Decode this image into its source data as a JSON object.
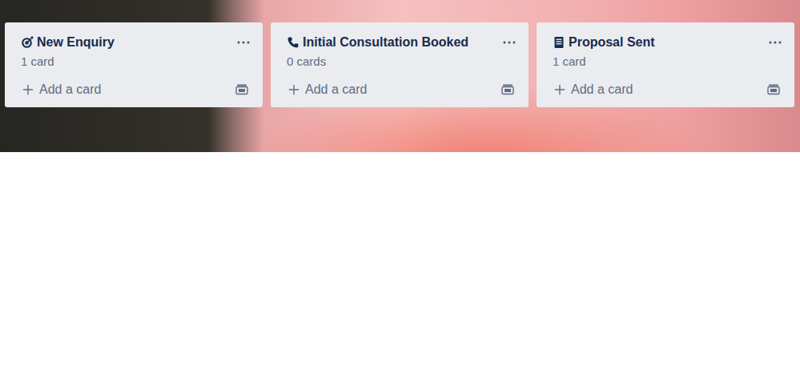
{
  "board": {
    "lists": [
      {
        "title": "New Enquiry",
        "count": "1 card",
        "add_label": "Add a card"
      },
      {
        "title": "Initial Consultation Booked",
        "count": "0 cards",
        "add_label": "Add a card"
      },
      {
        "title": "Proposal Sent",
        "count": "1 card",
        "add_label": "Add a card"
      }
    ]
  }
}
